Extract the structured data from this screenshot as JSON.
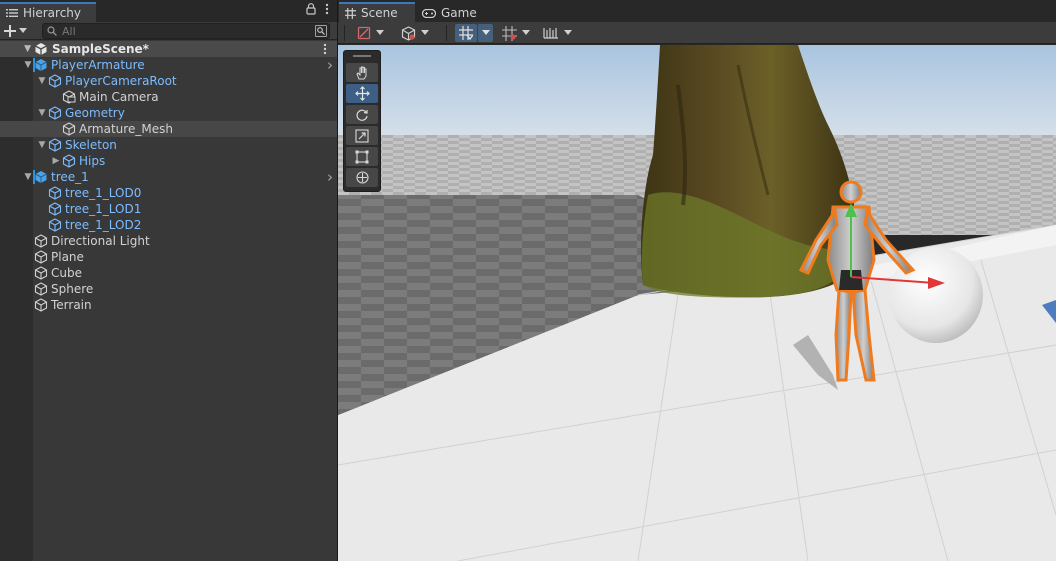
{
  "hierarchy": {
    "tab_label": "Hierarchy",
    "search_placeholder": "All",
    "scene_name": "SampleScene*",
    "items": [
      {
        "label": "PlayerArmature",
        "depth": 1,
        "expanded": true,
        "prefab": true,
        "root_prefab": true,
        "has_child_chevron": true
      },
      {
        "label": "PlayerCameraRoot",
        "depth": 2,
        "expanded": true,
        "prefab": true
      },
      {
        "label": "Main Camera",
        "depth": 3,
        "expanded": null,
        "prefab": false,
        "camera": true
      },
      {
        "label": "Geometry",
        "depth": 2,
        "expanded": true,
        "prefab": true
      },
      {
        "label": "Armature_Mesh",
        "depth": 3,
        "expanded": null,
        "prefab": false,
        "selected": true
      },
      {
        "label": "Skeleton",
        "depth": 2,
        "expanded": true,
        "prefab": true
      },
      {
        "label": "Hips",
        "depth": 3,
        "expanded": false,
        "prefab": true
      },
      {
        "label": "tree_1",
        "depth": 1,
        "expanded": true,
        "prefab": true,
        "root_prefab": true,
        "has_child_chevron": true
      },
      {
        "label": "tree_1_LOD0",
        "depth": 2,
        "expanded": null,
        "prefab": true
      },
      {
        "label": "tree_1_LOD1",
        "depth": 2,
        "expanded": null,
        "prefab": true
      },
      {
        "label": "tree_1_LOD2",
        "depth": 2,
        "expanded": null,
        "prefab": true
      },
      {
        "label": "Directional Light",
        "depth": 1,
        "expanded": null,
        "prefab": false
      },
      {
        "label": "Plane",
        "depth": 1,
        "expanded": null,
        "prefab": false
      },
      {
        "label": "Cube",
        "depth": 1,
        "expanded": null,
        "prefab": false
      },
      {
        "label": "Sphere",
        "depth": 1,
        "expanded": null,
        "prefab": false
      },
      {
        "label": "Terrain",
        "depth": 1,
        "expanded": null,
        "prefab": false
      }
    ]
  },
  "scene_view": {
    "tabs": [
      {
        "label": "Scene",
        "active": true,
        "icon": "grid-icon"
      },
      {
        "label": "Game",
        "active": false,
        "icon": "gamepad-icon"
      }
    ],
    "tools": [
      "hand-tool-icon",
      "move-tool-icon",
      "rotate-tool-icon",
      "scale-tool-icon",
      "rect-tool-icon",
      "transform-tool-icon"
    ],
    "active_tool": "move-tool-icon"
  },
  "colors": {
    "accent": "#3a79bb",
    "prefab_text": "#7dbcff",
    "selection_outline": "#f07a1e",
    "sky": "#bcd0e4"
  }
}
